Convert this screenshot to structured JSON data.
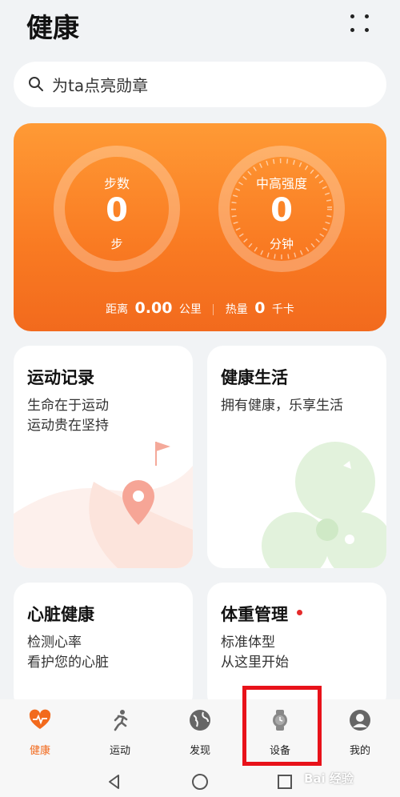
{
  "header": {
    "title": "健康"
  },
  "search": {
    "placeholder": "为ta点亮勋章"
  },
  "activity": {
    "steps": {
      "label": "步数",
      "value": "0",
      "unit": "步"
    },
    "intensity": {
      "label": "中高强度",
      "value": "0",
      "unit": "分钟"
    },
    "distance": {
      "label": "距离",
      "value": "0.00",
      "unit": "公里"
    },
    "calories": {
      "label": "热量",
      "value": "0",
      "unit": "千卡"
    }
  },
  "cards": [
    {
      "title": "运动记录",
      "line1": "生命在于运动",
      "line2": "运动贵在坚持"
    },
    {
      "title": "健康生活",
      "line1": "拥有健康，乐享生活"
    },
    {
      "title": "心脏健康",
      "line1": "检测心率",
      "line2": "看护您的心脏"
    },
    {
      "title": "体重管理",
      "line1": "标准体型",
      "line2": "从这里开始"
    }
  ],
  "tabs": [
    {
      "label": "健康",
      "icon": "heart-pulse-icon",
      "active": true
    },
    {
      "label": "运动",
      "icon": "running-icon"
    },
    {
      "label": "发现",
      "icon": "globe-icon"
    },
    {
      "label": "设备",
      "icon": "watch-icon"
    },
    {
      "label": "我的",
      "icon": "person-icon"
    }
  ],
  "navbar": {
    "icons": [
      "back-icon",
      "home-icon",
      "recents-icon"
    ]
  },
  "watermark": "Bai 经验",
  "colors": {
    "accent": "#f26a1d",
    "highlight": "#e8121a",
    "card_bg": "#ffffff",
    "page_bg": "#f1f3f5"
  }
}
